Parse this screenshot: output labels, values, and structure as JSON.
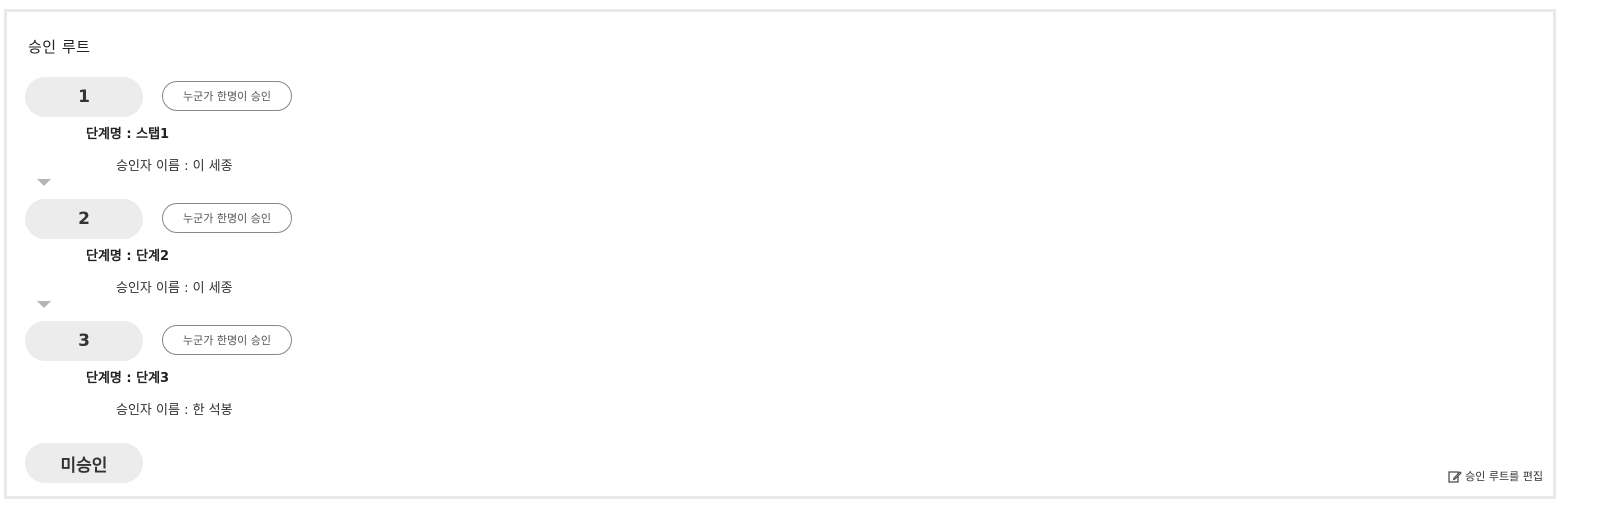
{
  "section_title": "승인 루트",
  "steps": [
    {
      "number": "1",
      "rule": "누군가 한명이 승인",
      "step_name": "단계명 : 스탭1",
      "approver": "승인자 이름 : 이 세종"
    },
    {
      "number": "2",
      "rule": "누군가 한명이 승인",
      "step_name": "단계명 : 단계2",
      "approver": "승인자 이름 : 이 세종"
    },
    {
      "number": "3",
      "rule": "누군가 한명이 승인",
      "step_name": "단계명 : 단계3",
      "approver": "승인자 이름 : 한 석봉"
    }
  ],
  "status": "미승인",
  "edit_link": {
    "label": "승인 루트를 편집",
    "icon": "edit-icon"
  },
  "colors": {
    "pill": "#ececec",
    "border": "#e9e9e9",
    "arrow": "#b5b5b5"
  }
}
